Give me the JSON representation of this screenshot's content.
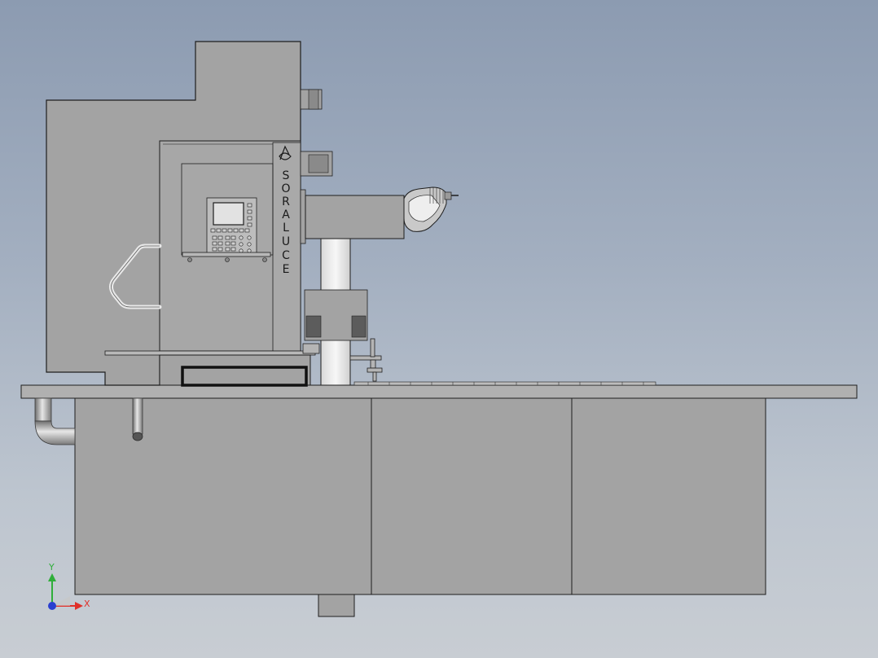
{
  "model": {
    "brand_text": "SORALUCE",
    "brand_letters": [
      "S",
      "O",
      "R",
      "A",
      "L",
      "U",
      "C",
      "E"
    ]
  },
  "triad": {
    "x_label": "X",
    "y_label": "Y",
    "x_color": "#e0302a",
    "y_color": "#2fae3a",
    "z_color": "#2a3fd0"
  },
  "colors": {
    "body": "#a3a3a3",
    "body_light": "#b2b2b2",
    "body_dark": "#8e8e8e",
    "outline": "#1e1e1e",
    "screen": "#e2e2e2"
  }
}
